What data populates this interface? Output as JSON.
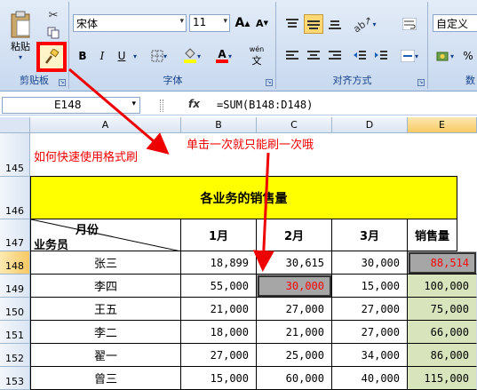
{
  "ribbon": {
    "clipboard": {
      "label": "剪贴板",
      "paste_label": "粘贴"
    },
    "font": {
      "label": "字体",
      "name": "宋体",
      "size": "11",
      "grow": "A",
      "shrink": "A",
      "bold": "B",
      "italic": "I",
      "underline": "U",
      "font_color": "A",
      "phonetic": "wén"
    },
    "alignment": {
      "label": "对齐方式"
    },
    "number": {
      "label": "数",
      "format": "自定义",
      "percent": "%"
    }
  },
  "formula_bar": {
    "name_box": "E148",
    "fx": "fx",
    "formula": "=SUM(B148:D148)"
  },
  "columns": [
    "A",
    "B",
    "C",
    "D",
    "E"
  ],
  "rows": [
    "145",
    "146",
    "147",
    "148",
    "149",
    "150",
    "151",
    "152",
    "153"
  ],
  "annotations": {
    "left": "如何快速使用格式刷",
    "top": "单击一次就只能刷一次哦"
  },
  "table": {
    "title": "各业务的销售量",
    "corner_top": "月份",
    "corner_bottom": "业务员",
    "headers": [
      "1月",
      "2月",
      "3月",
      "销售量"
    ],
    "data": [
      [
        "张三",
        "18,899",
        "30,615",
        "30,000",
        "88,514"
      ],
      [
        "李四",
        "55,000",
        "30,000",
        "15,000",
        "100,000"
      ],
      [
        "王五",
        "21,000",
        "27,000",
        "27,000",
        "75,000"
      ],
      [
        "李二",
        "18,000",
        "21,000",
        "27,000",
        "66,000"
      ],
      [
        "翟一",
        "27,000",
        "25,000",
        "34,000",
        "86,000"
      ],
      [
        "曾三",
        "15,000",
        "60,000",
        "40,000",
        "115,000"
      ]
    ]
  },
  "colors": {
    "title_fill": "#ffff00",
    "total_fill": "#d8e4bc",
    "selected_fill": "#a6a6a6",
    "highlight": "#ff0000",
    "annotation": "#ee0000"
  }
}
